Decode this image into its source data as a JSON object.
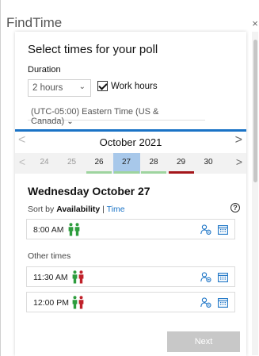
{
  "app": {
    "title": "FindTime",
    "close_glyph": "×"
  },
  "header": {
    "heading": "Select times for your poll"
  },
  "duration": {
    "label": "Duration",
    "selected": "2 hours",
    "chevron": "⌄"
  },
  "work_hours": {
    "label": "Work hours",
    "checked": true
  },
  "timezone": {
    "selected": "(UTC-05:00) Eastern Time (US & Canada)",
    "chevron": "⌄"
  },
  "calendar": {
    "month": "October 2021",
    "prev_glyph": "<",
    "next_glyph": ">",
    "days": [
      {
        "num": "24",
        "bar": "#f2f2f2",
        "muted": true,
        "selected": false
      },
      {
        "num": "25",
        "bar": "#f2f2f2",
        "muted": true,
        "selected": false
      },
      {
        "num": "26",
        "bar": "#9ed49f",
        "muted": false,
        "selected": false
      },
      {
        "num": "27",
        "bar": "#9ed49f",
        "muted": false,
        "selected": true
      },
      {
        "num": "28",
        "bar": "#9ed49f",
        "muted": false,
        "selected": false
      },
      {
        "num": "29",
        "bar": "#a4161a",
        "muted": false,
        "selected": false
      },
      {
        "num": "30",
        "bar": "#f2f2f2",
        "muted": false,
        "selected": false
      }
    ],
    "selected_bg": "#a8c8ea"
  },
  "selected_date": "Wednesday October 27",
  "sort": {
    "prefix": "Sort by",
    "active": "Availability",
    "separator": "|",
    "alternate": "Time"
  },
  "help_icon": "?",
  "best_slots": [
    {
      "time": "8:00 AM",
      "attendees": [
        "green",
        "green"
      ]
    }
  ],
  "other_times_label": "Other times",
  "other_slots": [
    {
      "time": "11:30 AM",
      "attendees": [
        "green",
        "red"
      ]
    },
    {
      "time": "12:00 PM",
      "attendees": [
        "green",
        "red"
      ]
    }
  ],
  "colors": {
    "accent": "#1a73c6",
    "available": "#2e9d3e",
    "busy": "#c0212a"
  },
  "next_button": {
    "label": "Next"
  }
}
